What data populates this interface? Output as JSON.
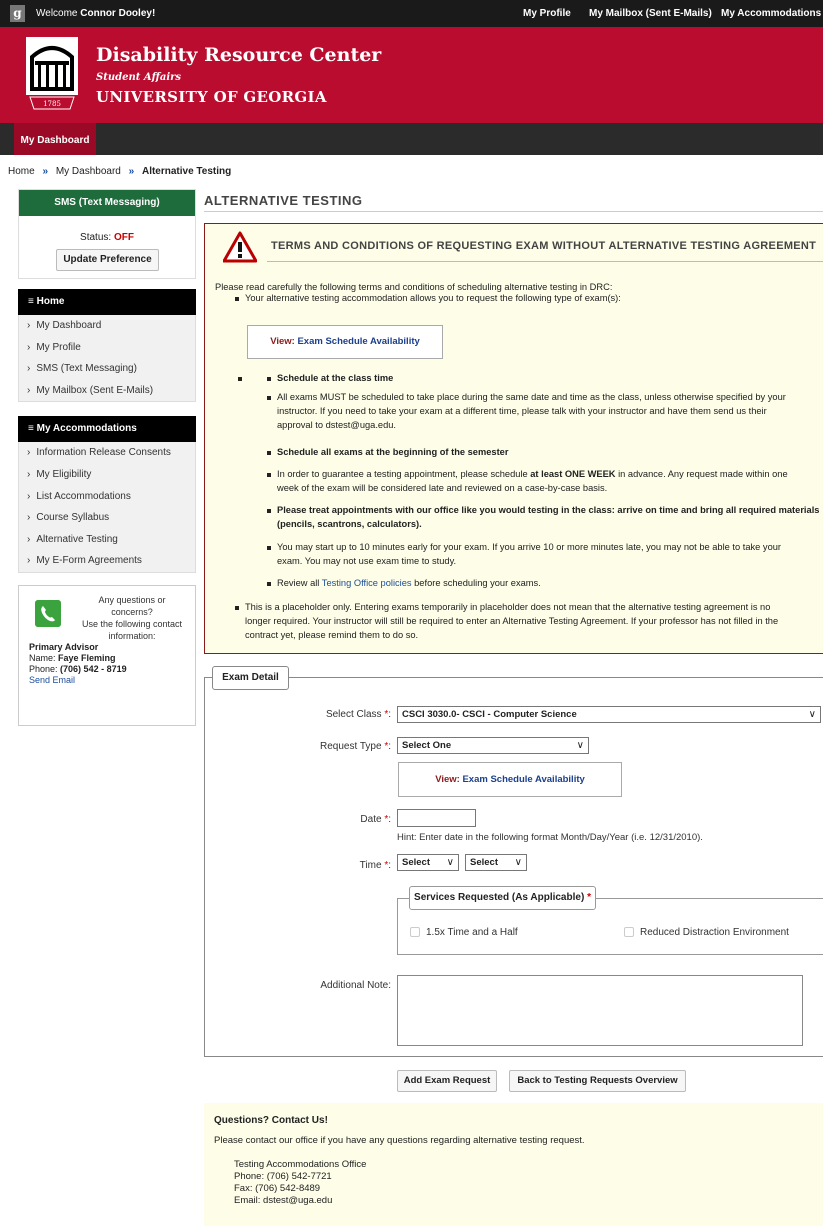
{
  "topbar": {
    "logo": "g",
    "welcome_prefix": "Welcome",
    "user": "Connor Dooley!",
    "links": [
      "My Profile",
      "My Mailbox (Sent E-Mails)",
      "My Accommodations"
    ]
  },
  "banner": {
    "title": "Disability Resource Center",
    "subtitle": "Student Affairs",
    "university": "UNIVERSITY OF GEORGIA",
    "year": "1785"
  },
  "nav": {
    "tab": "My Dashboard"
  },
  "breadcrumb": {
    "home": "Home",
    "dash": "My Dashboard",
    "current": "Alternative Testing",
    "sep": "»"
  },
  "sidebar": {
    "sms_title": "SMS (Text Messaging)",
    "status_label": "Status:",
    "status_value": "OFF",
    "update_button": "Update Preference",
    "home_title": "Home",
    "home_items": [
      "My Dashboard",
      "My Profile",
      "SMS (Text Messaging)",
      "My Mailbox (Sent E-Mails)"
    ],
    "acc_title": "My Accommodations",
    "acc_items": [
      "Information Release Consents",
      "My Eligibility",
      "List Accommodations",
      "Course Syllabus",
      "Alternative Testing",
      "My E-Form Agreements"
    ],
    "contact_q1": "Any questions or concerns?",
    "contact_q2": "Use the following contact",
    "contact_q3": "information:",
    "advisor_label": "Primary Advisor",
    "name_label": "Name:",
    "name_value": "Faye Fleming",
    "phone_label": "Phone:",
    "phone_value": "(706) 542 - 8719",
    "send_email": "Send Email"
  },
  "main": {
    "title": "ALTERNATIVE TESTING",
    "terms_title": "TERMS AND CONDITIONS OF REQUESTING EXAM WITHOUT ALTERNATIVE TESTING AGREEMENT",
    "intro": "Please read carefully the following terms and conditions of scheduling alternative testing in DRC:",
    "b1": "Your alternative testing accommodation allows you to request the following type of exam(s):",
    "view_label": "View:",
    "view_link": "Exam Schedule Availability",
    "s1_title": "Schedule at the class time",
    "s1_a1": "All exams MUST be scheduled to take place during the same date and time as the class, unless otherwise specified by your",
    "s1_a2": "instructor. If you need to take your exam at a different time, please talk with your instructor and have them send us their",
    "s1_a3": "approval to dstest@uga.edu.",
    "s2_title": "Schedule all exams at the beginning of the semester",
    "s2_a1a": "In order to guarantee a testing appointment, please schedule",
    "s2_a1b": "at least ONE WEEK",
    "s2_a1c": "in advance. Any request made within one",
    "s2_a2": "week of the exam will be considered late and reviewed on a case-by-case basis.",
    "s3_1": "Please treat appointments with our office like you would testing in the class: arrive on time and bring all required materials",
    "s3_2": "(pencils, scantrons, calculators).",
    "s4_1": "You may start up to 10 minutes early for your exam. If you arrive 10 or more minutes late, you may not be able to take your",
    "s4_2": "exam. You may not use exam time to study.",
    "s5_a": "Review all",
    "s5_link": "Testing Office policies",
    "s5_b": "before scheduling your exams.",
    "b2_1": "This is a placeholder only. Entering exams temporarily in placeholder does not mean that the alternative testing agreement is no",
    "b2_2": "longer required. Your instructor will still be required to enter an Alternative Testing Agreement. If your professor has not filled in the",
    "b2_3": "contract yet, please remind them to do so."
  },
  "form": {
    "legend": "Exam Detail",
    "select_class_label": "Select Class",
    "select_class_value": "CSCI 3030.0- CSCI - Computer Science",
    "request_type_label": "Request Type",
    "request_type_value": "Select One",
    "date_label": "Date",
    "date_value": "",
    "date_hint": "Hint: Enter date in the following format Month/Day/Year (i.e. 12/31/2010).",
    "time_label": "Time",
    "time_hour": "Select",
    "time_min": "Select",
    "services_legend": "Services Requested (As Applicable)",
    "svc1": "1.5x Time and a Half",
    "svc2": "Reduced Distraction Environment",
    "note_label": "Additional Note:",
    "note_value": "",
    "required_mark": "*",
    "colon": ":",
    "add_button": "Add Exam Request",
    "back_button": "Back to Testing Requests Overview"
  },
  "contact": {
    "title": "Questions? Contact Us!",
    "text": "Please contact our office if you have any questions regarding alternative testing request.",
    "office": "Testing Accommodations Office",
    "phone": "Phone: (706) 542-7721",
    "fax": "Fax: (706) 542-8489",
    "email": "Email: dstest@uga.edu"
  },
  "colors": {
    "brand_red": "#ba0c2f",
    "dark_red": "#9a0a26",
    "sms_green": "#1e6b3c",
    "notice_bg": "#fdfde8",
    "link_blue": "#1b4e9b"
  },
  "icons": [
    "uga-logo-icon",
    "arch-logo-icon",
    "warning-triangle-icon",
    "phone-icon",
    "chevron-down-icon",
    "double-chevron-icon",
    "arrow-right-icon"
  ]
}
